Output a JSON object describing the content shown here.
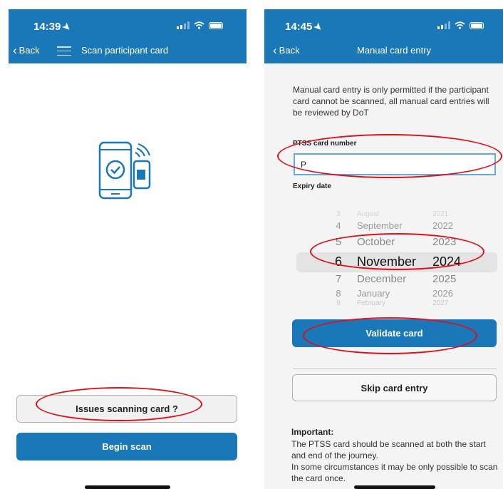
{
  "left_screen": {
    "status": {
      "time": "14:39"
    },
    "nav": {
      "back_label": "Back",
      "title": "Scan participant card"
    },
    "buttons": {
      "issues_label": "Issues scanning card ?",
      "begin_label": "Begin scan"
    }
  },
  "right_screen": {
    "status": {
      "time": "14:45"
    },
    "nav": {
      "back_label": "Back",
      "title": "Manual card entry"
    },
    "intro": "Manual card entry is only permitted if the participant card cannot be scanned, all manual card entries will be reviewed by DoT",
    "card_label": "PTSS card number",
    "card_value": "P",
    "expiry_label": "Expiry date",
    "picker_rows": [
      {
        "day": "3",
        "month": "August",
        "year": "2021"
      },
      {
        "day": "4",
        "month": "September",
        "year": "2022"
      },
      {
        "day": "5",
        "month": "October",
        "year": "2023"
      },
      {
        "day": "6",
        "month": "November",
        "year": "2024"
      },
      {
        "day": "7",
        "month": "December",
        "year": "2025"
      },
      {
        "day": "8",
        "month": "January",
        "year": "2026"
      },
      {
        "day": "9",
        "month": "February",
        "year": "2027"
      }
    ],
    "validate_label": "Validate card",
    "skip_label": "Skip card entry",
    "important_title": "Important:",
    "important_text_1": "The PTSS card should be scanned at both the start and end of the journey.",
    "important_text_2": "In some circumstances it may be only possible to scan the card once."
  },
  "colors": {
    "brand": "#1a78b8",
    "highlight_ellipse": "#e0101a"
  }
}
